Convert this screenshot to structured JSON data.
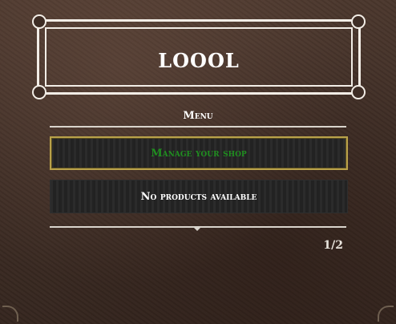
{
  "header": {
    "title": "LOOOL"
  },
  "menu": {
    "subtitle": "Menu",
    "items": [
      {
        "label": "Manage your shop",
        "selected": true,
        "color": "#1f8f1f"
      },
      {
        "label": "No products available",
        "selected": false,
        "color": "#ffffff"
      }
    ]
  },
  "pagination": {
    "text": "1/2"
  }
}
